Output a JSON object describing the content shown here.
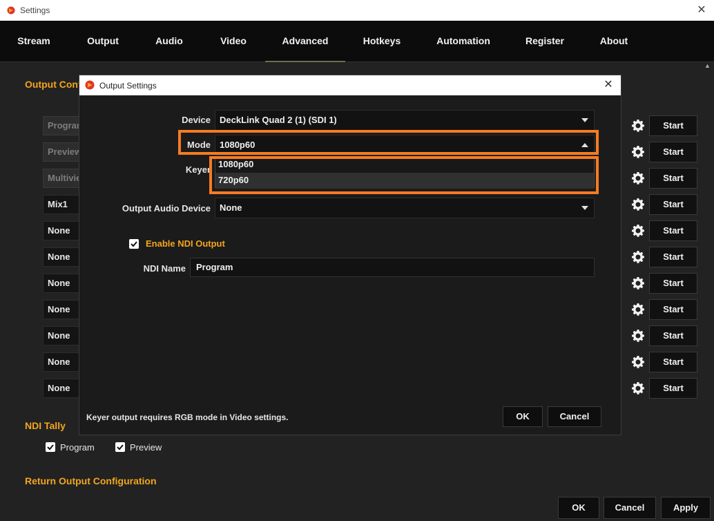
{
  "window": {
    "title": "Settings",
    "close_glyph": "✕"
  },
  "tabs": [
    {
      "label": "Stream"
    },
    {
      "label": "Output"
    },
    {
      "label": "Audio"
    },
    {
      "label": "Video"
    },
    {
      "label": "Advanced",
      "active": true
    },
    {
      "label": "Hotkeys"
    },
    {
      "label": "Automation"
    },
    {
      "label": "Register"
    },
    {
      "label": "About"
    }
  ],
  "background": {
    "output_config_title": "Output Conf",
    "sources": [
      {
        "label": "Program",
        "dim": true
      },
      {
        "label": "Preview",
        "dim": true
      },
      {
        "label": "Multiview",
        "dim": true
      },
      {
        "label": "Mix1"
      },
      {
        "label": "None"
      },
      {
        "label": "None"
      },
      {
        "label": "None"
      },
      {
        "label": "None"
      },
      {
        "label": "None"
      },
      {
        "label": "None"
      },
      {
        "label": "None"
      }
    ],
    "start_label": "Start",
    "ndi_tally_title": "NDI Tally",
    "tally_program": "Program",
    "tally_preview": "Preview",
    "return_output_title": "Return Output Configuration"
  },
  "footer": {
    "ok": "OK",
    "cancel": "Cancel",
    "apply": "Apply"
  },
  "modal": {
    "title": "Output Settings",
    "close_glyph": "✕",
    "device_label": "Device",
    "device_value": "DeckLink Quad 2 (1) (SDI 1)",
    "mode_label": "Mode",
    "mode_value": "1080p60",
    "mode_options": [
      "1080p60",
      "720p60"
    ],
    "keyer_label": "Keyer",
    "audio_device_label": "Output Audio Device",
    "audio_device_value": "None",
    "enable_ndi_label": "Enable NDI Output",
    "ndi_name_label": "NDI Name",
    "ndi_name_value": "Program",
    "note": "Keyer output requires RGB mode in Video settings.",
    "ok": "OK",
    "cancel": "Cancel"
  },
  "colors": {
    "accent": "#f3a51f",
    "highlight": "#f57c22"
  },
  "icons": {
    "settings": "gear-icon",
    "check": "check-icon",
    "app": "app-logo-icon"
  }
}
